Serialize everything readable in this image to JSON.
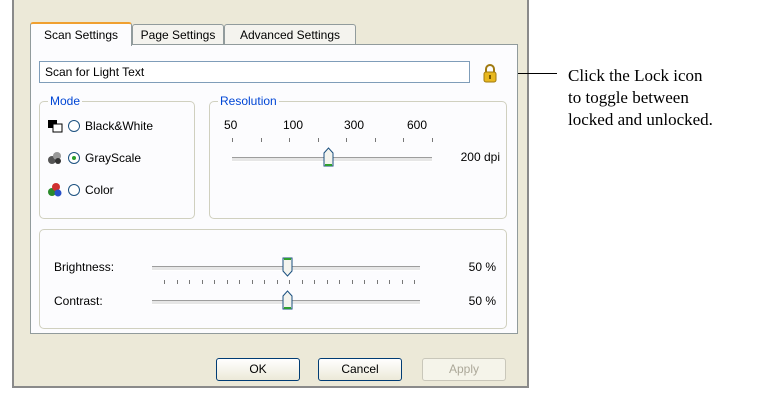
{
  "tabs": [
    {
      "label": "Scan Settings"
    },
    {
      "label": "Page Settings"
    },
    {
      "label": "Advanced Settings"
    }
  ],
  "preset": {
    "value": "Scan for Light Text"
  },
  "lock": {
    "icon": "lock-icon",
    "color": "#e8b820"
  },
  "mode": {
    "title": "Mode",
    "options": [
      {
        "label": "Black&White",
        "selected": false,
        "icon": "black-white-icon"
      },
      {
        "label": "GrayScale",
        "selected": true,
        "icon": "grayscale-icon"
      },
      {
        "label": "Color",
        "selected": false,
        "icon": "color-icon"
      }
    ]
  },
  "resolution": {
    "title": "Resolution",
    "ticks": [
      "50",
      "100",
      "300",
      "600"
    ],
    "value_label": "200 dpi"
  },
  "brightness": {
    "label": "Brightness:",
    "value_label": "50 %",
    "value": 50
  },
  "contrast": {
    "label": "Contrast:",
    "value_label": "50 %",
    "value": 50
  },
  "buttons": {
    "ok": "OK",
    "cancel": "Cancel",
    "apply": "Apply"
  },
  "callout": {
    "lines": [
      "Click the Lock icon",
      "to toggle between",
      "locked and unlocked."
    ]
  }
}
